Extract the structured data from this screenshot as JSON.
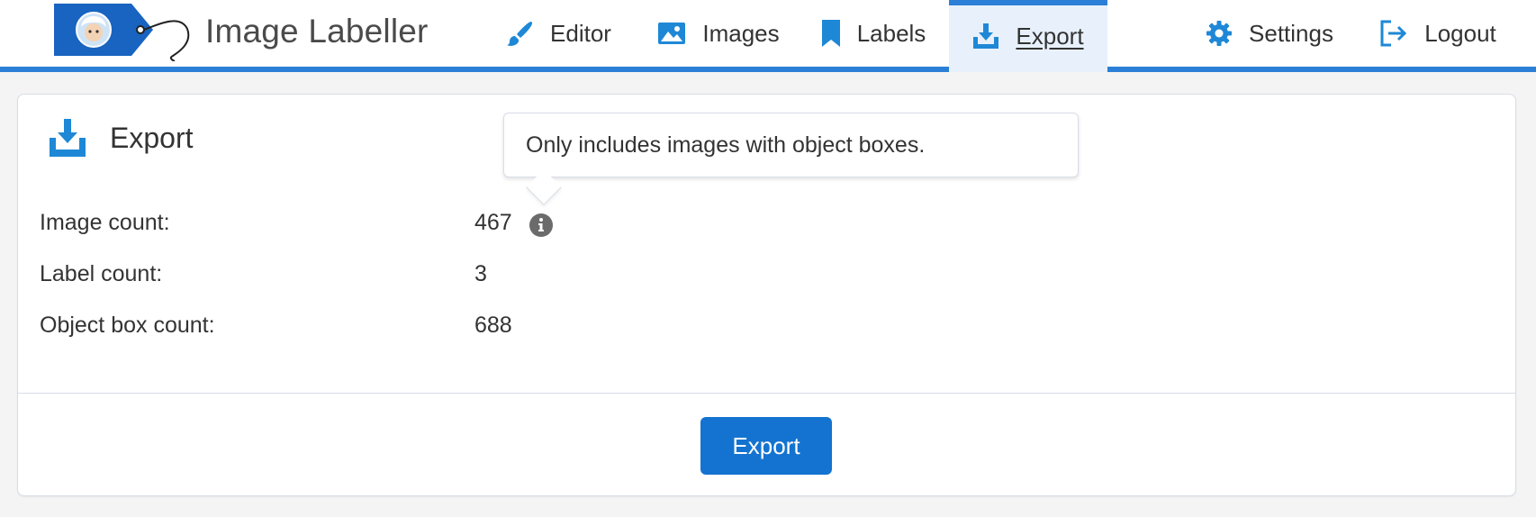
{
  "app": {
    "name": "Image Labeller"
  },
  "nav": {
    "editor": "Editor",
    "images": "Images",
    "labels": "Labels",
    "export": "Export",
    "settings": "Settings",
    "logout": "Logout",
    "active": "export"
  },
  "colors": {
    "accent": "#2b7fd6",
    "icon": "#1e88d6",
    "button": "#1473d0",
    "active_tab_bg": "#e8f1fb"
  },
  "icons": {
    "editor": "brush-icon",
    "images": "image-icon",
    "labels": "bookmark-icon",
    "export": "download-tray-icon",
    "settings": "gear-icon",
    "logout": "logout-icon",
    "info": "info-icon",
    "logo": "tag-logo-icon"
  },
  "export_panel": {
    "title": "Export",
    "stats": [
      {
        "label": "Image count:",
        "value": "467"
      },
      {
        "label": "Label count:",
        "value": "3"
      },
      {
        "label": "Object box count:",
        "value": "688"
      }
    ],
    "tooltip": "Only includes images with object boxes.",
    "button_label": "Export"
  }
}
